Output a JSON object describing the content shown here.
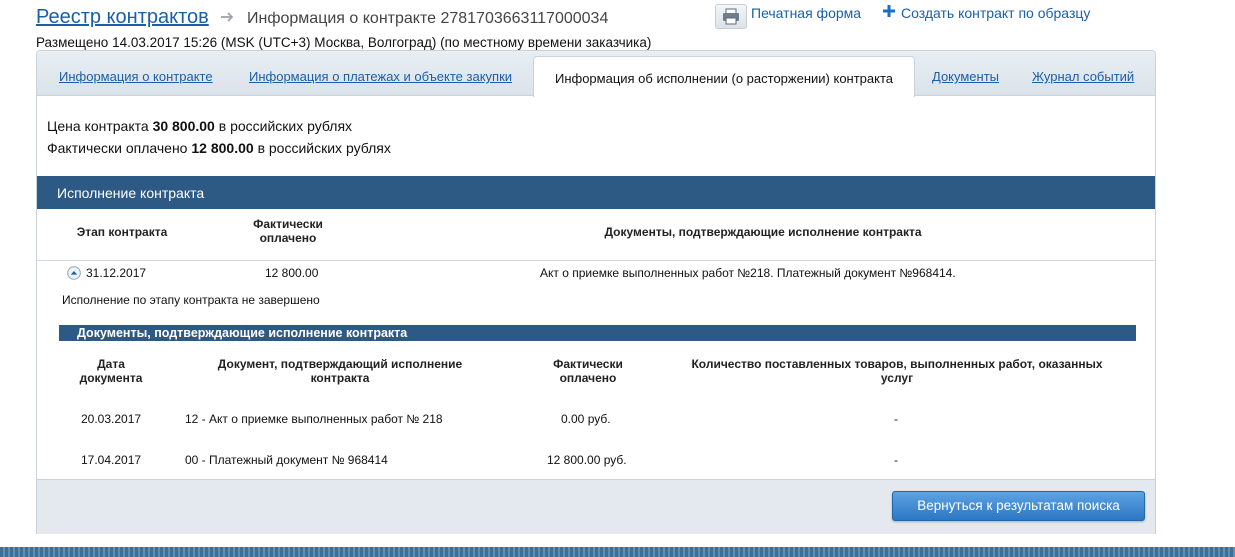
{
  "header": {
    "breadcrumb_root": "Реестр контрактов",
    "breadcrumb_current": "Информация о контракте 2781703663117000034",
    "placed": "Размещено 14.03.2017 15:26 (MSK (UTC+3) Москва, Волгоград) (по местному времени заказчика)",
    "print_label": "Печатная форма",
    "create_label": "Создать контракт по образцу"
  },
  "tabs": [
    {
      "label": "Информация о контракте",
      "active": false
    },
    {
      "label": "Информация о платежах и объекте закупки",
      "active": false
    },
    {
      "label": "Информация об исполнении (о расторжении) контракта",
      "active": true
    },
    {
      "label": "Документы",
      "active": false
    },
    {
      "label": "Журнал событий",
      "active": false
    }
  ],
  "summary": {
    "price_prefix": "Цена контракта",
    "price_value": "30 800.00",
    "price_suffix": "в российских рублях",
    "paid_prefix": "Фактически оплачено",
    "paid_value": "12 800.00",
    "paid_suffix": "в российских рублях"
  },
  "execution": {
    "title": "Исполнение контракта",
    "columns": {
      "stage": "Этап контракта",
      "paid_line1": "Фактически",
      "paid_line2": "оплачено",
      "docs": "Документы, подтверждающие исполнение контракта"
    },
    "row": {
      "stage_date": "31.12.2017",
      "paid": "12 800.00",
      "docs": "Акт о приемке выполненных работ №218. Платежный документ №968414."
    },
    "status": "Исполнение по этапу контракта не завершено"
  },
  "documents": {
    "title": "Документы, подтверждающие исполнение контракта",
    "columns": {
      "date_line1": "Дата",
      "date_line2": "документа",
      "doc_line1": "Документ, подтверждающий исполнение",
      "doc_line2": "контракта",
      "paid_line1": "Фактически",
      "paid_line2": "оплачено",
      "qty_line1": "Количество поставленных товаров, выполненных работ, оказанных",
      "qty_line2": "услуг"
    },
    "rows": [
      {
        "date": "20.03.2017",
        "doc": "12 - Акт о приемке выполненных работ № 218",
        "paid": "0.00 руб.",
        "qty": "-"
      },
      {
        "date": "17.04.2017",
        "doc": "00 - Платежный документ № 968414",
        "paid": "12 800.00 руб.",
        "qty": "-"
      }
    ]
  },
  "footer": {
    "back_label": "Вернуться к результатам поиска"
  },
  "colors": {
    "link": "#1a5fa8",
    "section_bar": "#2c5a85",
    "button": "#2c77c4"
  }
}
